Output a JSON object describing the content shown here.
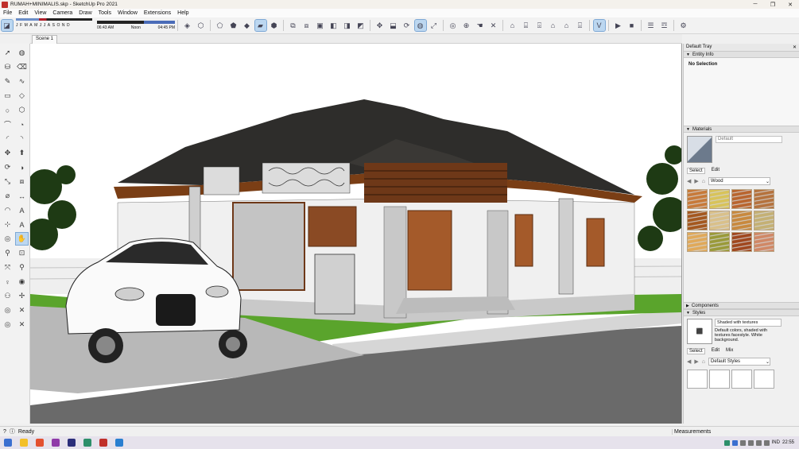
{
  "window": {
    "title": "RUMAH+MINIMALIS.skp - SketchUp Pro 2021",
    "controls": [
      "─",
      "❐",
      "✕"
    ]
  },
  "menu": [
    "File",
    "Edit",
    "View",
    "Camera",
    "Draw",
    "Tools",
    "Window",
    "Extensions",
    "Help"
  ],
  "shadow": {
    "months": [
      "J",
      "F",
      "M",
      "A",
      "M",
      "J",
      "J",
      "A",
      "S",
      "O",
      "N",
      "D"
    ],
    "time_start": "06:43 AM",
    "time_mid": "Noon",
    "time_end": "04:45 PM"
  },
  "scene_tab": "Scene 1",
  "tray": {
    "title": "Default Tray",
    "entity_info": {
      "header": "Entity Info",
      "value": "No Selection"
    },
    "materials": {
      "header": "Materials",
      "name": "Default",
      "tabs": [
        "Select",
        "Edit"
      ],
      "library": "Wood",
      "swatches": [
        "#c77a3a",
        "#d8c35a",
        "#b9652f",
        "#b5733e",
        "#a4581f",
        "#d9c08a",
        "#c8893e",
        "#c4b074",
        "#e0a95a",
        "#9a9a3a",
        "#a0481f",
        "#d08866"
      ]
    },
    "components": {
      "header": "Components"
    },
    "styles": {
      "header": "Styles",
      "name": "Shaded with textures",
      "description": "Default colors, shaded with textures facestyle. White background.",
      "tabs": [
        "Select",
        "Edit",
        "Mix"
      ],
      "library": "Default Styles"
    }
  },
  "status": {
    "text": "Ready",
    "measurements_label": "Measurements"
  },
  "taskbar": {
    "lang": "IND",
    "time": "22:55"
  },
  "colors": {
    "viewport_bg": "#ffffff",
    "selected_tool": "#bcd7f0",
    "roof": "#2e2d2b"
  }
}
